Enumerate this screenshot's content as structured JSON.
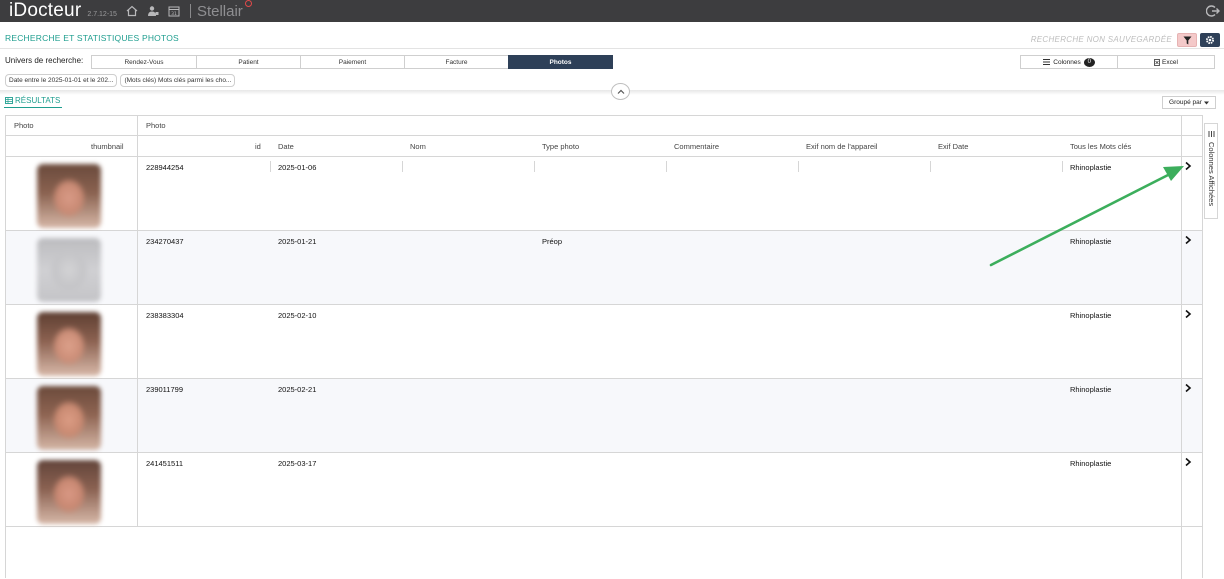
{
  "header": {
    "brand": "iDocteur",
    "version": "2.7.12-15",
    "stellair": "Stellair"
  },
  "titlebar": {
    "title": "RECHERCHE ET STATISTIQUES PHOTOS",
    "unsaved": "RECHERCHE NON SAUVEGARDÉE"
  },
  "univers": {
    "label": "Univers de recherche:",
    "tabs": [
      "Rendez-Vous",
      "Patient",
      "Paiement",
      "Facture",
      "Photos"
    ],
    "active_tab": "Photos",
    "colonnes_label": "Colonnes",
    "colonnes_count": "0",
    "excel_label": "Excel"
  },
  "chips": [
    "Date entre le 2025-01-01 et le 202...",
    "(Mots clés) Mots clés parmi les cho..."
  ],
  "results": {
    "label": "RÉSULTATS",
    "groupe_label": "Groupé par"
  },
  "grid": {
    "group_headers": [
      "Photo",
      "Photo"
    ],
    "columns": [
      "thumbnail",
      "id",
      "Date",
      "Nom",
      "Type photo",
      "Commentaire",
      "Exif nom de l'appareil",
      "Exif Date",
      "Tous les Mots clés"
    ],
    "rows": [
      {
        "id": "228944254",
        "date": "2025-01-06",
        "nom": "",
        "type": "",
        "commentaire": "",
        "exif_app": "",
        "exif_date": "",
        "mots": "Rhinoplastie"
      },
      {
        "id": "234270437",
        "date": "2025-01-21",
        "nom": "",
        "type": "Préop",
        "commentaire": "",
        "exif_app": "",
        "exif_date": "",
        "mots": "Rhinoplastie"
      },
      {
        "id": "238383304",
        "date": "2025-02-10",
        "nom": "",
        "type": "",
        "commentaire": "",
        "exif_app": "",
        "exif_date": "",
        "mots": "Rhinoplastie"
      },
      {
        "id": "239011799",
        "date": "2025-02-21",
        "nom": "",
        "type": "",
        "commentaire": "",
        "exif_app": "",
        "exif_date": "",
        "mots": "Rhinoplastie"
      },
      {
        "id": "241451511",
        "date": "2025-03-17",
        "nom": "",
        "type": "",
        "commentaire": "",
        "exif_app": "",
        "exif_date": "",
        "mots": "Rhinoplastie"
      }
    ]
  },
  "side_tab": {
    "label": "Colonnes Affichées"
  },
  "colors": {
    "accent": "#1f9e8f",
    "active_tab": "#2e4058",
    "topbar": "#3d3d3f",
    "annotation_arrow": "#3cae5c"
  }
}
